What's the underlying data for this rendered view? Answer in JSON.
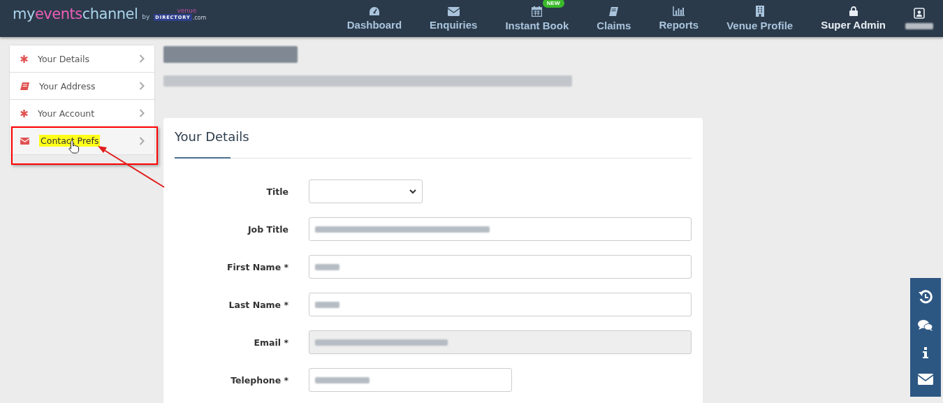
{
  "header": {
    "logo": {
      "parts": [
        {
          "text": "my",
          "color": "#a9d3ea"
        },
        {
          "text": "events",
          "color": "#ee5fb7"
        },
        {
          "text": "channel",
          "color": "#a9d3ea"
        }
      ],
      "by": "by",
      "venue": "venue",
      "directory": "DIRECTORY",
      ".com": ".com"
    },
    "nav": [
      {
        "label": "Dashboard"
      },
      {
        "label": "Enquiries"
      },
      {
        "label": "Instant Book",
        "badge": "NEW"
      },
      {
        "label": "Claims"
      },
      {
        "label": "Reports"
      },
      {
        "label": "Venue Profile"
      },
      {
        "label": "Super Admin"
      }
    ]
  },
  "sidebar": {
    "items": [
      {
        "label": "Your Details",
        "selected": false
      },
      {
        "label": "Your Address",
        "selected": false
      },
      {
        "label": "Your Account",
        "selected": false
      },
      {
        "label": "Contact Prefs",
        "selected": true
      }
    ]
  },
  "card": {
    "title": "Your Details",
    "fields": [
      {
        "label": "Title",
        "kind": "select",
        "disabled": false
      },
      {
        "label": "Job Title",
        "kind": "text",
        "disabled": false
      },
      {
        "label": "First Name *",
        "kind": "text",
        "disabled": false
      },
      {
        "label": "Last Name *",
        "kind": "text",
        "disabled": false
      },
      {
        "label": "Email *",
        "kind": "text",
        "disabled": true
      },
      {
        "label": "Telephone *",
        "kind": "short",
        "disabled": false
      }
    ]
  }
}
